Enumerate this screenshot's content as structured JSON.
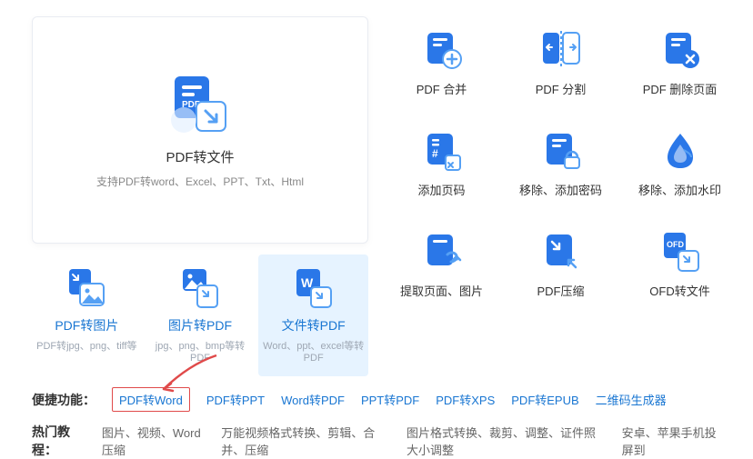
{
  "hero": {
    "title": "PDF转文件",
    "subtitle": "支持PDF转word、Excel、PPT、Txt、Html"
  },
  "subcards": [
    {
      "title": "PDF转图片",
      "desc": "PDF转jpg、png、tiff等"
    },
    {
      "title": "图片转PDF",
      "desc": "jpg、png、bmp等转PDF"
    },
    {
      "title": "文件转PDF",
      "desc": "Word、ppt、excel等转PDF"
    }
  ],
  "grid": [
    "PDF 合并",
    "PDF 分割",
    "PDF 删除页面",
    "添加页码",
    "移除、添加密码",
    "移除、添加水印",
    "提取页面、图片",
    "PDF压缩",
    "OFD转文件"
  ],
  "footer": {
    "quick_label": "便捷功能：",
    "quick_links": [
      "PDF转Word",
      "PDF转PPT",
      "Word转PDF",
      "PPT转PDF",
      "PDF转XPS",
      "PDF转EPUB",
      "二维码生成器"
    ],
    "hot_label": "热门教程：",
    "hot_links": [
      "图片、视频、Word压缩",
      "万能视频格式转换、剪辑、合并、压缩",
      "图片格式转换、裁剪、调整、证件照大小调整",
      "安卓、苹果手机投屏到"
    ]
  }
}
